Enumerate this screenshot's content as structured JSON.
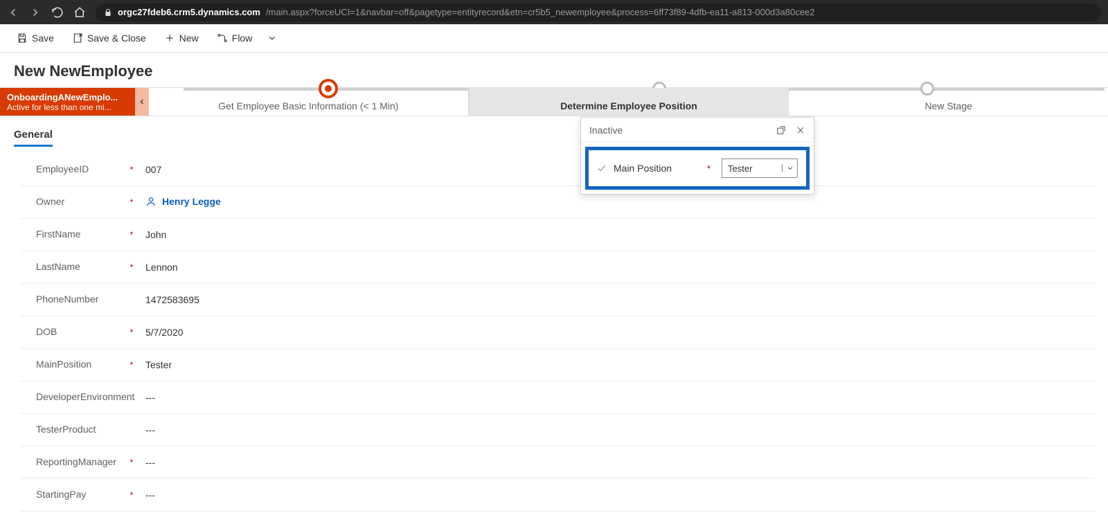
{
  "browser": {
    "domain": "orgc27fdeb6.crm5.dynamics.com",
    "path": "/main.aspx?forceUCI=1&navbar=off&pagetype=entityrecord&etn=cr5b5_newemployee&process=6ff73f89-4dfb-ea11-a813-000d3a80cee2"
  },
  "commands": {
    "save": "Save",
    "save_close": "Save & Close",
    "new": "New",
    "flow": "Flow"
  },
  "page": {
    "title": "New NewEmployee"
  },
  "bpf": {
    "status_title": "OnboardingANewEmplo...",
    "status_sub": "Active for less than one mi...",
    "stages": {
      "a": "Get Employee Basic Information  (< 1 Min)",
      "b": "Determine Employee Position",
      "c": "New Stage"
    }
  },
  "flyout": {
    "status": "Inactive",
    "field_label": "Main Position",
    "field_value": "Tester"
  },
  "tabs": {
    "general": "General"
  },
  "fields": [
    {
      "label": "EmployeeID",
      "required": true,
      "value": "007",
      "type": "text"
    },
    {
      "label": "Owner",
      "required": true,
      "value": "Henry Legge",
      "type": "owner"
    },
    {
      "label": "FirstName",
      "required": true,
      "value": "John",
      "type": "text"
    },
    {
      "label": "LastName",
      "required": true,
      "value": "Lennon",
      "type": "text"
    },
    {
      "label": "PhoneNumber",
      "required": false,
      "value": "1472583695",
      "type": "text"
    },
    {
      "label": "DOB",
      "required": true,
      "value": "5/7/2020",
      "type": "text"
    },
    {
      "label": "MainPosition",
      "required": true,
      "value": "Tester",
      "type": "text"
    },
    {
      "label": "DeveloperEnvironment",
      "required": false,
      "value": "---",
      "type": "text"
    },
    {
      "label": "TesterProduct",
      "required": false,
      "value": "---",
      "type": "text"
    },
    {
      "label": "ReportingManager",
      "required": true,
      "value": "---",
      "type": "text"
    },
    {
      "label": "StartingPay",
      "required": true,
      "value": "---",
      "type": "text"
    }
  ]
}
